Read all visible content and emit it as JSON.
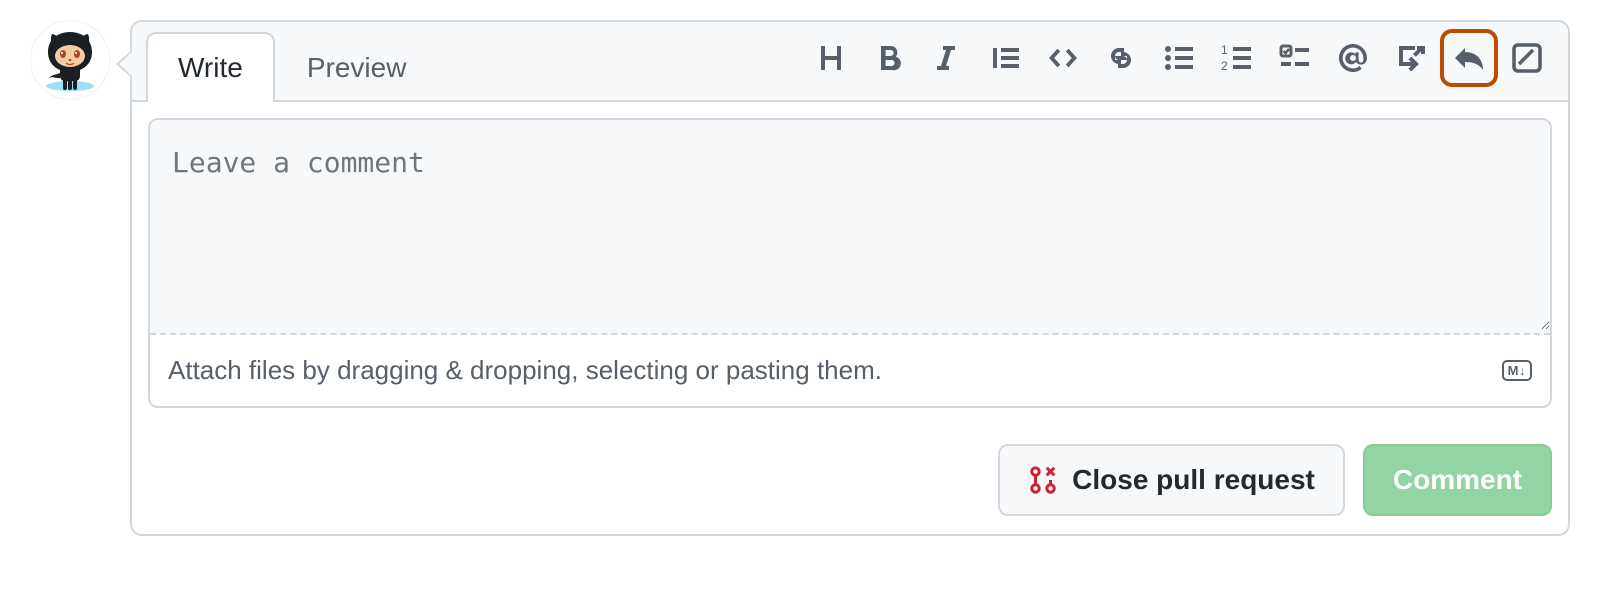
{
  "tabs": {
    "write": "Write",
    "preview": "Preview"
  },
  "toolbar_icons": {
    "heading": "heading-icon",
    "bold": "bold-icon",
    "italic": "italic-icon",
    "quote": "quote-icon",
    "code": "code-icon",
    "link": "link-icon",
    "ul": "unordered-list-icon",
    "ol": "ordered-list-icon",
    "tasklist": "tasklist-icon",
    "mention": "mention-icon",
    "crossref": "cross-reference-icon",
    "reply": "reply-icon",
    "suggestion": "suggestion-icon"
  },
  "editor": {
    "placeholder": "Leave a comment",
    "attach_hint": "Attach files by dragging & dropping, selecting or pasting them.",
    "markdown_badge": "M↓"
  },
  "buttons": {
    "close": "Close pull request",
    "comment": "Comment"
  }
}
